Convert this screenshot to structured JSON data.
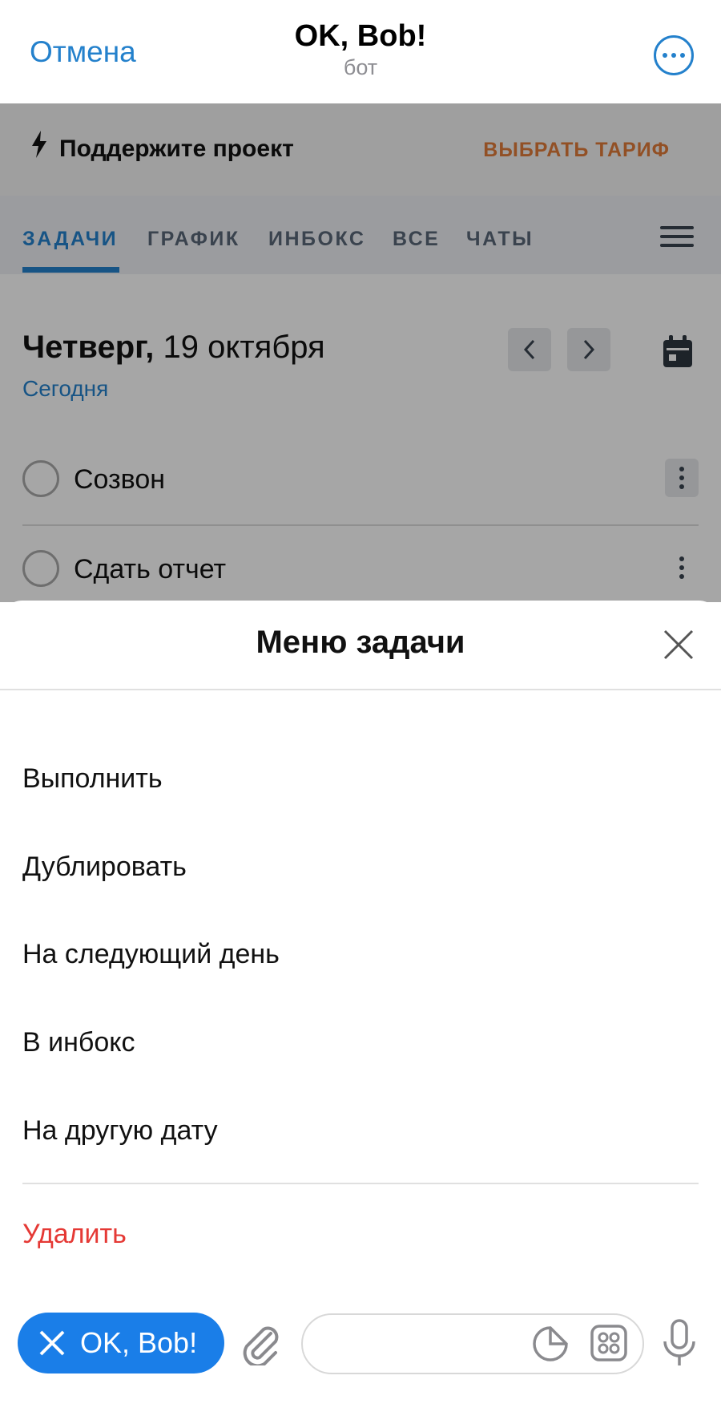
{
  "header": {
    "cancel_label": "Отмена",
    "title": "OK, Bob!",
    "subtitle": "бот"
  },
  "app": {
    "promo": {
      "text": "Поддержите проект",
      "link": "ВЫБРАТЬ ТАРИФ"
    },
    "tabs": [
      {
        "label": "ЗАДАЧИ",
        "active": true
      },
      {
        "label": "ГРАФИК",
        "active": false
      },
      {
        "label": "ИНБОКС",
        "active": false
      },
      {
        "label": "ВСЕ",
        "active": false
      },
      {
        "label": "ЧАТЫ",
        "active": false
      }
    ],
    "day_name": "Четверг,",
    "date": " 19 октября",
    "today_label": "Сегодня",
    "tasks": [
      {
        "label": "Созвон"
      },
      {
        "label": "Сдать отчет"
      }
    ]
  },
  "sheet": {
    "title": "Меню задачи",
    "items": [
      {
        "label": "Выполнить"
      },
      {
        "label": "Дублировать"
      },
      {
        "label": "На следующий день"
      },
      {
        "label": "В инбокс"
      },
      {
        "label": "На другую дату"
      }
    ],
    "delete_label": "Удалить"
  },
  "input_bar": {
    "bot_button_label": "OK, Bob!",
    "message_value": ""
  },
  "colors": {
    "accent": "#2481cc",
    "promo_link": "#e07b39",
    "danger": "#e53935",
    "bot_button": "#1a7ee8"
  }
}
